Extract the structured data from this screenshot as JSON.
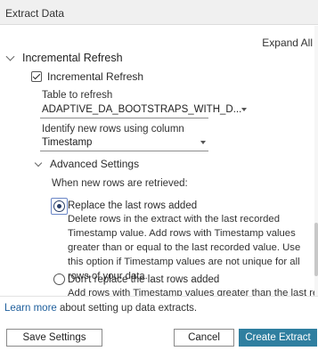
{
  "window": {
    "title": "Extract Data"
  },
  "toolbar": {
    "expand_all": "Expand All"
  },
  "incremental": {
    "section_title": "Incremental Refresh",
    "checkbox_label": "Incremental Refresh",
    "checked": true,
    "table_label": "Table to refresh",
    "table_value": "ADAPTIVE_DA_BOOTSTRAPS_WITH_D...",
    "column_label": "Identify new rows using column",
    "column_value": "Timestamp"
  },
  "advanced": {
    "title": "Advanced Settings",
    "prompt": "When new rows are retrieved:",
    "options": [
      {
        "label": "Replace the last rows added",
        "selected": true,
        "description": "Delete rows in the extract with the last recorded Timestamp value. Add rows with Timestamp values greater than or equal to the last recorded value. Use this option if Timestamp values are not unique for all rows of your data."
      },
      {
        "label": "Don't replace the last rows added",
        "selected": false,
        "description": "Add rows with Timestamp values greater than the last recorded value."
      }
    ]
  },
  "footer": {
    "learn_more_link": "Learn more",
    "learn_more_text": " about setting up data extracts.",
    "save_settings": "Save Settings",
    "cancel": "Cancel",
    "create_extract": "Create Extract"
  },
  "colors": {
    "primary_button": "#2f7fa0",
    "link": "#1f5f9c",
    "radio_selected": "#2a3f6a"
  }
}
